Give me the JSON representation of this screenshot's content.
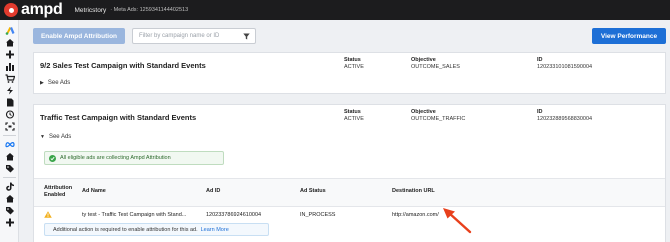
{
  "topbar": {
    "logo": "ampd",
    "account": "Metricstory",
    "meta_ads_label": "· Meta Ads: 1259341144402513"
  },
  "sidebar": {
    "icons": [
      "google-ads-icon",
      "home-icon",
      "add-icon",
      "bar-chart-icon",
      "cart-icon",
      "lightning-icon",
      "file-icon",
      "history-icon",
      "scan-icon",
      "meta-icon",
      "home-icon",
      "tag-icon",
      "tiktok-icon",
      "home-icon",
      "tag-icon",
      "add-icon"
    ]
  },
  "toolbar": {
    "enable_label": "Enable Ampd Attribution",
    "filter_placeholder": "Filter by campaign name or ID",
    "view_performance_label": "View Performance"
  },
  "columns": {
    "status": "Status",
    "objective": "Objective",
    "id": "ID"
  },
  "campaigns": [
    {
      "name": "9/2 Sales Test Campaign with Standard Events",
      "status": "ACTIVE",
      "objective": "OUTCOME_SALES",
      "id": "120233101081590004",
      "see_ads": "See Ads"
    },
    {
      "name": "Traffic Test Campaign with Standard Events",
      "status": "ACTIVE",
      "objective": "OUTCOME_TRAFFIC",
      "id": "120232889568830004",
      "see_ads": "See Ads"
    }
  ],
  "banner": "All eligible ads are collecting Ampd Attribution",
  "ads_table": {
    "headers": {
      "attribution_1": "Attribution",
      "attribution_2": "Enabled",
      "ad_name": "Ad Name",
      "ad_id": "Ad ID",
      "ad_status": "Ad Status",
      "destination": "Destination URL"
    },
    "rows": [
      {
        "ad_name": "ty test - Traffic Test Campaign with Stand...",
        "ad_id": "120233786924610004",
        "ad_status": "IN_PROCESS",
        "destination": "http://amazon.com/"
      }
    ]
  },
  "note": {
    "text": "Additional action is required to enable attribution for this ad.",
    "link": "Learn More"
  },
  "colors": {
    "accent": "#1d6fd6",
    "brand_red": "#e23b2e",
    "success": "#3aa54a",
    "warning": "#f2b01e",
    "annotation_arrow": "#e8401c"
  }
}
